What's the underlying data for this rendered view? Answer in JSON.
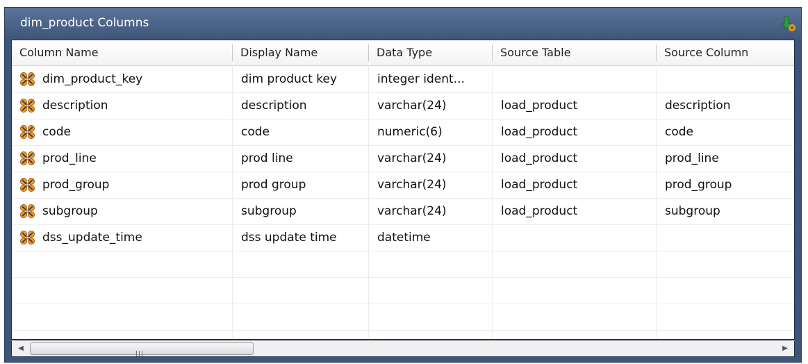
{
  "window": {
    "title": "dim_product Columns"
  },
  "grid": {
    "columns": [
      "Column Name",
      "Display Name",
      "Data Type",
      "Source Table",
      "Source Column"
    ],
    "rows": [
      [
        "dim_product_key",
        "dim product key",
        "integer ident...",
        "",
        ""
      ],
      [
        "description",
        "description",
        "varchar(24)",
        "load_product",
        "description"
      ],
      [
        "code",
        "code",
        "numeric(6)",
        "load_product",
        "code"
      ],
      [
        "prod_line",
        "prod line",
        "varchar(24)",
        "load_product",
        "prod_line"
      ],
      [
        "prod_group",
        "prod group",
        "varchar(24)",
        "load_product",
        "prod_group"
      ],
      [
        "subgroup",
        "subgroup",
        "varchar(24)",
        "load_product",
        "subgroup"
      ],
      [
        "dss_update_time",
        "dss update time",
        "datetime",
        "",
        ""
      ]
    ],
    "row_icon": "column-key-icon"
  },
  "icons": {
    "title_action": "green-arrow-icon",
    "scroll_left": "arrow-left-icon",
    "scroll_right": "arrow-right-icon"
  },
  "colors": {
    "titlebar": "#3d5578",
    "title_text": "#ffffff"
  }
}
